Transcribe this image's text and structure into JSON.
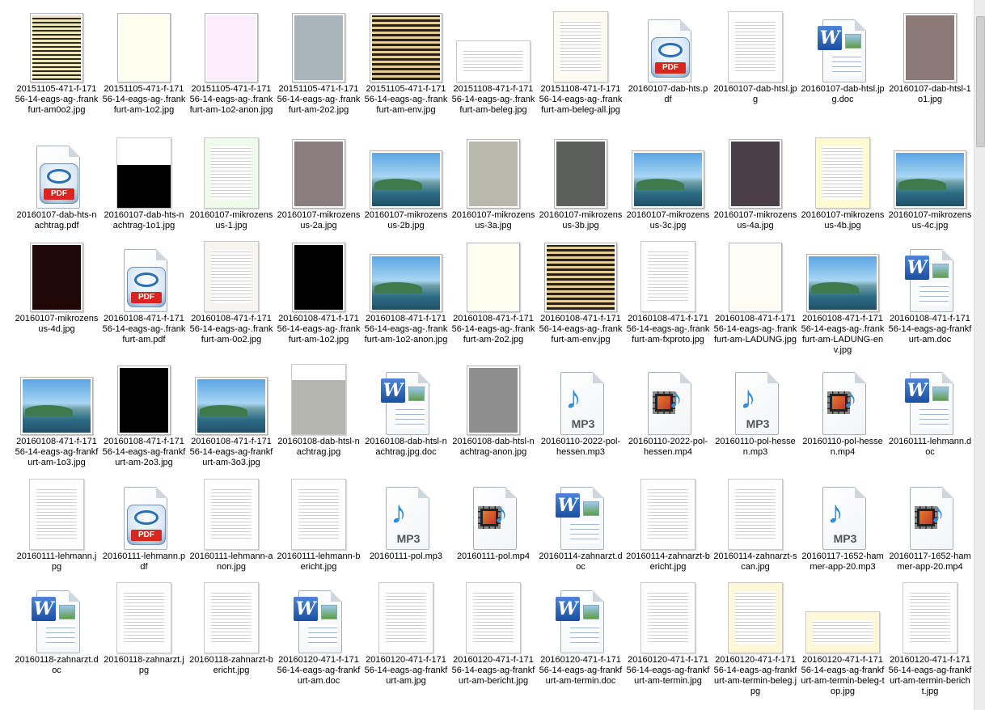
{
  "items": [
    {
      "name": "20151105-471-f-17156-14-eags-ag-.frankfurt-am0o2.jpg",
      "type": "stripes",
      "tw": 66,
      "th": 86,
      "c1": "#2a2a1f"
    },
    {
      "name": "20151105-471-f-17156-14-eags-ag-.frankfurt-am-1o2.jpg",
      "type": "solid",
      "tw": 66,
      "th": 86,
      "c1": "#fffff0"
    },
    {
      "name": "20151105-471-f-17156-14-eags-ag-.frankfurt-am-1o2-anon.jpg",
      "type": "solid",
      "tw": 66,
      "th": 86,
      "c1": "#fbeefa"
    },
    {
      "name": "20151105-471-f-17156-14-eags-ag-.frankfurt-am-2o2.jpg",
      "type": "solid",
      "tw": 66,
      "th": 86,
      "c1": "#a9b5bb"
    },
    {
      "name": "20151105-471-f-17156-14-eags-ag-.frankfurt-am-env.jpg",
      "type": "lines",
      "tw": 90,
      "th": 86,
      "c1": "#e2c26a"
    },
    {
      "name": "20151108-471-f-17156-14-eags-ag-.frankfurt-am-beleg.jpg",
      "type": "doc",
      "tw": 90,
      "th": 50,
      "c1": "#ffffff"
    },
    {
      "name": "20151108-471-f-17156-14-eags-ag-.frankfurt-am-beleg-all.jpg",
      "type": "doc",
      "tw": 66,
      "th": 86,
      "c1": "#fcfbf2"
    },
    {
      "name": "20160107-dab-hts.pdf",
      "type": "pdf",
      "tw": 62,
      "th": 78,
      "c1": ""
    },
    {
      "name": "20160107-dab-htsl.jpg",
      "type": "doc",
      "tw": 66,
      "th": 86,
      "c1": "#ffffff"
    },
    {
      "name": "20160107-dab-htsl.jpg.doc",
      "type": "word",
      "tw": 62,
      "th": 78,
      "c1": ""
    },
    {
      "name": "20160107-dab-htsl-1o1.jpg",
      "type": "solid",
      "tw": 66,
      "th": 86,
      "c1": "#8c7a78"
    },
    {
      "name": "20160107-dab-hts-nachtrag.pdf",
      "type": "pdf",
      "tw": 62,
      "th": 78,
      "c1": ""
    },
    {
      "name": "20160107-dab-hts-nachtrag-1o1.jpg",
      "type": "blackdoc",
      "tw": 66,
      "th": 86,
      "c1": "#000000"
    },
    {
      "name": "20160107-mikrozensus-1.jpg",
      "type": "doc",
      "tw": 66,
      "th": 86,
      "c1": "#eefbea"
    },
    {
      "name": "20160107-mikrozensus-2a.jpg",
      "type": "solid",
      "tw": 66,
      "th": 86,
      "c1": "#8a7d80"
    },
    {
      "name": "20160107-mikrozensus-2b.jpg",
      "type": "landscape",
      "tw": 90,
      "th": 72,
      "c1": ""
    },
    {
      "name": "20160107-mikrozensus-3a.jpg",
      "type": "solid",
      "tw": 66,
      "th": 86,
      "c1": "#b9b8ad"
    },
    {
      "name": "20160107-mikrozensus-3b.jpg",
      "type": "solid",
      "tw": 66,
      "th": 86,
      "c1": "#5c5f5c"
    },
    {
      "name": "20160107-mikrozensus-3c.jpg",
      "type": "landscape",
      "tw": 90,
      "th": 72,
      "c1": ""
    },
    {
      "name": "20160107-mikrozensus-4a.jpg",
      "type": "solid",
      "tw": 66,
      "th": 86,
      "c1": "#4a3f49"
    },
    {
      "name": "20160107-mikrozensus-4b.jpg",
      "type": "doc",
      "tw": 66,
      "th": 86,
      "c1": "#fffbd0"
    },
    {
      "name": "20160107-mikrozensus-4c.jpg",
      "type": "landscape",
      "tw": 90,
      "th": 72,
      "c1": ""
    },
    {
      "name": "20160107-mikrozensus-4d.jpg",
      "type": "solid",
      "tw": 66,
      "th": 86,
      "c1": "#210808"
    },
    {
      "name": "20160108-471-f-17156-14-eags-ag-.frankfurt-am.pdf",
      "type": "pdf",
      "tw": 62,
      "th": 78,
      "c1": ""
    },
    {
      "name": "20160108-471-f-17156-14-eags-ag-.frankfurt-am-0o2.jpg",
      "type": "doc",
      "tw": 66,
      "th": 86,
      "c1": "#f6f4ee"
    },
    {
      "name": "20160108-471-f-17156-14-eags-ag-.frankfurt-am-1o2.jpg",
      "type": "solid",
      "tw": 66,
      "th": 86,
      "c1": "#000000"
    },
    {
      "name": "20160108-471-f-17156-14-eags-ag-.frankfurt-am-1o2-anon.jpg",
      "type": "landscape",
      "tw": 90,
      "th": 72,
      "c1": ""
    },
    {
      "name": "20160108-471-f-17156-14-eags-ag-.frankfurt-am-2o2.jpg",
      "type": "solid",
      "tw": 66,
      "th": 86,
      "c1": "#fffff0"
    },
    {
      "name": "20160108-471-f-17156-14-eags-ag-.frankfurt-am-env.jpg",
      "type": "lines",
      "tw": 90,
      "th": 86,
      "c1": "#e2c26a"
    },
    {
      "name": "20160108-471-f-17156-14-eags-ag-.frankfurt-am-fxproto.jpg",
      "type": "doc",
      "tw": 66,
      "th": 86,
      "c1": "#ffffff"
    },
    {
      "name": "20160108-471-f-17156-14-eags-ag-.frankfurt-am-LADUNG.jpg",
      "type": "solid",
      "tw": 66,
      "th": 86,
      "c1": "#fdfdf5"
    },
    {
      "name": "20160108-471-f-17156-14-eags-ag-.frankfurt-am-LADUNG-env.jpg",
      "type": "landscape",
      "tw": 90,
      "th": 72,
      "c1": ""
    },
    {
      "name": "20160108-471-f-17156-14-eags-ag-frankfurt-am.doc",
      "type": "word",
      "tw": 62,
      "th": 78,
      "c1": ""
    },
    {
      "name": "20160108-471-f-17156-14-eags-ag-frankfurt-am-1o3.jpg",
      "type": "landscape",
      "tw": 90,
      "th": 72,
      "c1": ""
    },
    {
      "name": "20160108-471-f-17156-14-eags-ag-frankfurt-am-2o3.jpg",
      "type": "solid",
      "tw": 66,
      "th": 86,
      "c1": "#000000"
    },
    {
      "name": "20160108-471-f-17156-14-eags-ag-frankfurt-am-3o3.jpg",
      "type": "landscape",
      "tw": 90,
      "th": 72,
      "c1": ""
    },
    {
      "name": "20160108-dab-htsl-nachtrag.jpg",
      "type": "graydoc",
      "tw": 66,
      "th": 86,
      "c1": "#b5b5b0"
    },
    {
      "name": "20160108-dab-htsl-nachtrag.jpg.doc",
      "type": "word",
      "tw": 62,
      "th": 78,
      "c1": ""
    },
    {
      "name": "20160108-dab-htsl-nachtrag-anon.jpg",
      "type": "solid",
      "tw": 66,
      "th": 86,
      "c1": "#8e8e8e"
    },
    {
      "name": "20160110-2022-pol-hessen.mp3",
      "type": "mp3",
      "tw": 62,
      "th": 78,
      "c1": ""
    },
    {
      "name": "20160110-2022-pol-hessen.mp4",
      "type": "mp4",
      "tw": 62,
      "th": 78,
      "c1": ""
    },
    {
      "name": "20160110-pol-hessen.mp3",
      "type": "mp3",
      "tw": 62,
      "th": 78,
      "c1": ""
    },
    {
      "name": "20160110-pol-hessen.mp4",
      "type": "mp4",
      "tw": 62,
      "th": 78,
      "c1": ""
    },
    {
      "name": "20160111-lehmann.doc",
      "type": "word",
      "tw": 62,
      "th": 78,
      "c1": ""
    },
    {
      "name": "20160111-lehmann.jpg",
      "type": "doc",
      "tw": 66,
      "th": 86,
      "c1": "#ffffff"
    },
    {
      "name": "20160111-lehmann.pdf",
      "type": "pdf",
      "tw": 62,
      "th": 78,
      "c1": ""
    },
    {
      "name": "20160111-lehmann-anon.jpg",
      "type": "doc",
      "tw": 66,
      "th": 86,
      "c1": "#ffffff"
    },
    {
      "name": "20160111-lehmann-bericht.jpg",
      "type": "doc",
      "tw": 66,
      "th": 86,
      "c1": "#ffffff"
    },
    {
      "name": "20160111-pol.mp3",
      "type": "mp3",
      "tw": 62,
      "th": 78,
      "c1": ""
    },
    {
      "name": "20160111-pol.mp4",
      "type": "mp4",
      "tw": 62,
      "th": 78,
      "c1": ""
    },
    {
      "name": "20160114-zahnarzt.doc",
      "type": "word",
      "tw": 62,
      "th": 78,
      "c1": ""
    },
    {
      "name": "20160114-zahnarzt-bericht.jpg",
      "type": "doc",
      "tw": 66,
      "th": 86,
      "c1": "#ffffff"
    },
    {
      "name": "20160114-zahnarzt-scan.jpg",
      "type": "doc",
      "tw": 66,
      "th": 86,
      "c1": "#ffffff"
    },
    {
      "name": "20160117-1652-hammer-app-20.mp3",
      "type": "mp3",
      "tw": 62,
      "th": 78,
      "c1": ""
    },
    {
      "name": "20160117-1652-hammer-app-20.mp4",
      "type": "mp4",
      "tw": 62,
      "th": 78,
      "c1": ""
    },
    {
      "name": "20160118-zahnarzt.doc",
      "type": "word",
      "tw": 62,
      "th": 78,
      "c1": ""
    },
    {
      "name": "20160118-zahnarzt.jpg",
      "type": "doc",
      "tw": 66,
      "th": 86,
      "c1": "#ffffff"
    },
    {
      "name": "20160118-zahnarzt-bericht.jpg",
      "type": "doc",
      "tw": 66,
      "th": 86,
      "c1": "#ffffff"
    },
    {
      "name": "20160120-471-f-17156-14-eags-ag-frankfurt-am.doc",
      "type": "word",
      "tw": 62,
      "th": 78,
      "c1": ""
    },
    {
      "name": "20160120-471-f-17156-14-eags-ag-frankfurt-am.jpg",
      "type": "doc",
      "tw": 66,
      "th": 86,
      "c1": "#ffffff"
    },
    {
      "name": "20160120-471-f-17156-14-eags-ag-frankfurt-am-bericht.jpg",
      "type": "doc",
      "tw": 66,
      "th": 86,
      "c1": "#ffffff"
    },
    {
      "name": "20160120-471-f-17156-14-eags-ag-frankfurt-am-termin.doc",
      "type": "word",
      "tw": 62,
      "th": 78,
      "c1": ""
    },
    {
      "name": "20160120-471-f-17156-14-eags-ag-frankfurt-am-termin.jpg",
      "type": "doc",
      "tw": 66,
      "th": 86,
      "c1": "#ffffff"
    },
    {
      "name": "20160120-471-f-17156-14-eags-ag-frankfurt-am-termin-beleg.jpg",
      "type": "doc",
      "tw": 66,
      "th": 86,
      "c1": "#fff8d8"
    },
    {
      "name": "20160120-471-f-17156-14-eags-ag-frankfurt-am-termin-beleg-top.jpg",
      "type": "doc",
      "tw": 90,
      "th": 50,
      "c1": "#fff8d8"
    },
    {
      "name": "20160120-471-f-17156-14-eags-ag-frankfurt-am-termin-bericht.jpg",
      "type": "doc",
      "tw": 66,
      "th": 86,
      "c1": "#ffffff"
    }
  ]
}
